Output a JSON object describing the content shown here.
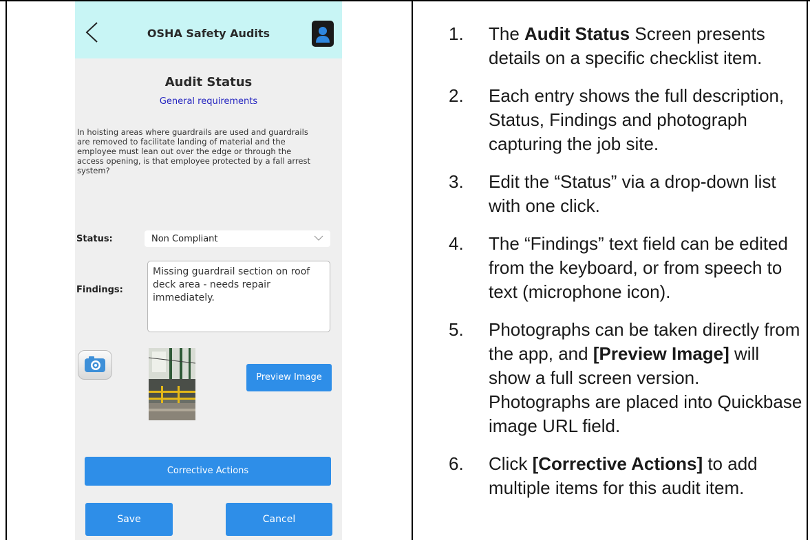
{
  "app": {
    "title": "OSHA Safety Audits"
  },
  "screen": {
    "title": "Audit Status",
    "subtitle": "General requirements",
    "question": "In hoisting areas where guardrails are used and guardrails are removed to facilitate landing of material and the employee must lean out over the edge or through the access opening, is that employee protected by a fall arrest system?"
  },
  "form": {
    "status_label": "Status:",
    "status_value": "Non Compliant",
    "findings_label": "Findings:",
    "findings_value": "Missing guardrail section on roof deck area - needs repair immediately."
  },
  "buttons": {
    "preview": "Preview Image",
    "corrective": "Corrective Actions",
    "save": "Save",
    "cancel": "Cancel"
  },
  "icons": {
    "back": "back-chevron-icon",
    "avatar": "user-avatar-icon",
    "camera": "camera-icon",
    "dropdown": "chevron-down-icon"
  },
  "colors": {
    "appbar": "#c8f5f5",
    "button": "#2e8ee8",
    "subtitle": "#2525c0",
    "screen_bg": "#efefef"
  },
  "instructions": [
    {
      "num": "1.",
      "pre": "The ",
      "bold": "Audit Status",
      "post": " Screen presents details on a specific checklist item."
    },
    {
      "num": "2.",
      "pre": "Each entry shows the full description, Status, Findings and photograph capturing the job site.",
      "bold": "",
      "post": ""
    },
    {
      "num": "3.",
      "pre": "Edit the “Status” via a drop-down list with one click.",
      "bold": "",
      "post": ""
    },
    {
      "num": "4.",
      "pre": "The “Findings” text field can be edited from the keyboard, or from speech to text (microphone icon).",
      "bold": "",
      "post": ""
    },
    {
      "num": "5.",
      "pre": "Photographs can be taken directly from the app, and ",
      "bold": "[Preview Image]",
      "post": " will show a full screen version. Photographs are placed into Quickbase image URL field."
    },
    {
      "num": "6.",
      "pre": "Click ",
      "bold": "[Corrective Actions]",
      "post": " to add multiple items for this audit item."
    }
  ]
}
